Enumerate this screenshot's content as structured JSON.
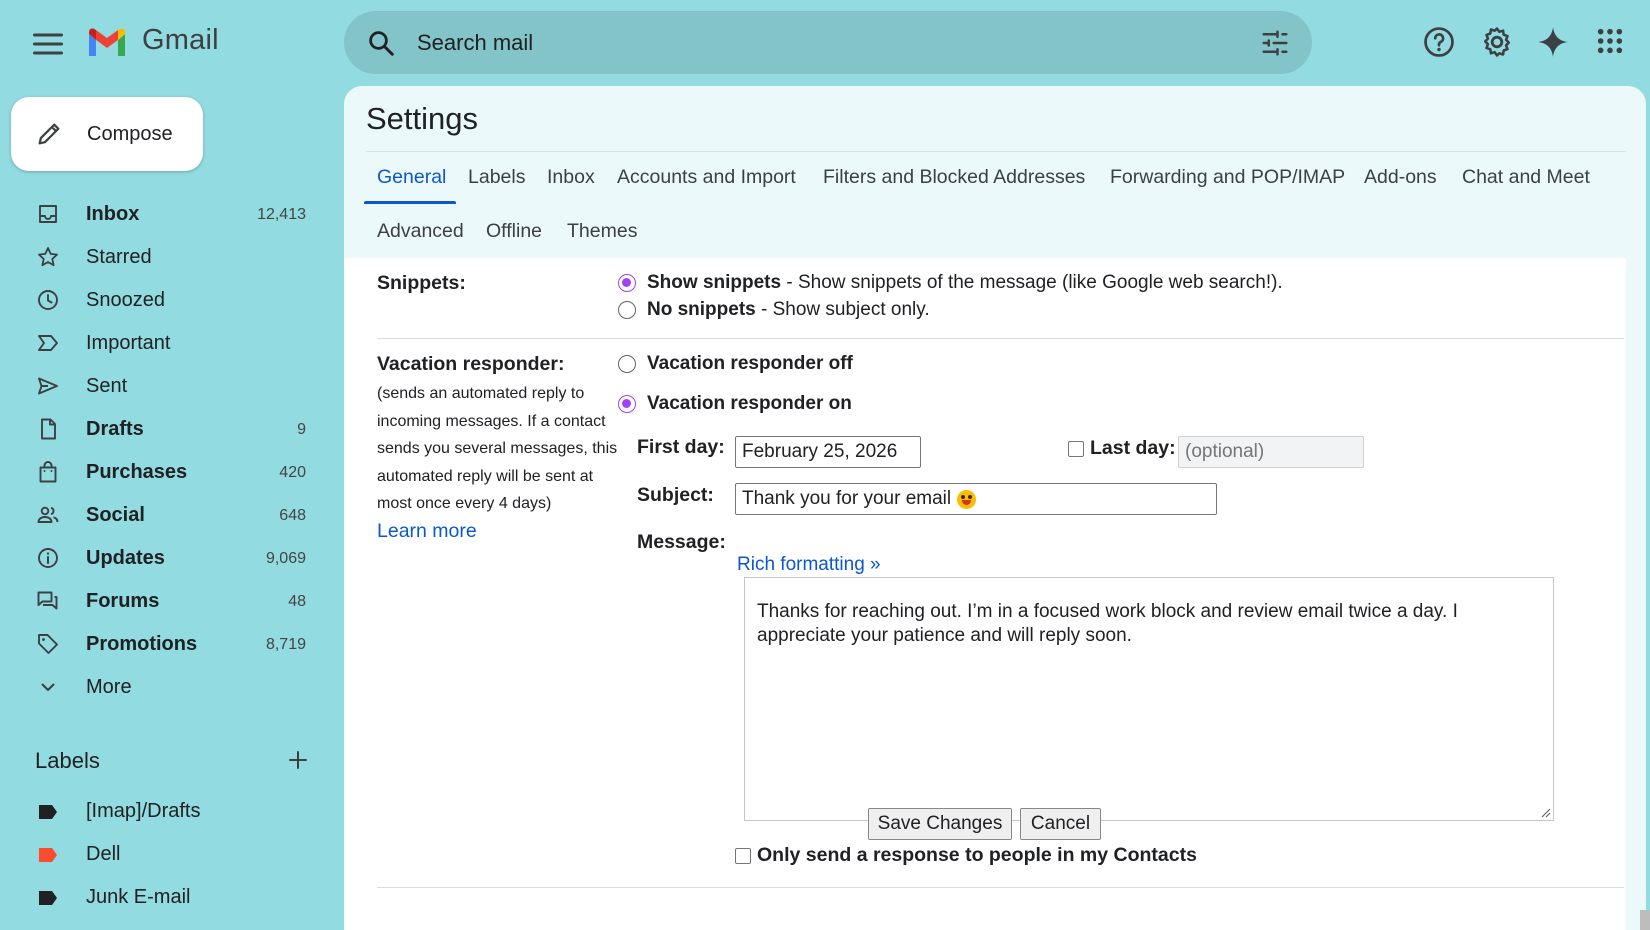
{
  "header": {
    "app_name": "Gmail",
    "search_placeholder": "Search mail"
  },
  "sidebar": {
    "compose_label": "Compose",
    "items": [
      {
        "label": "Inbox",
        "count": "12,413",
        "bold": true,
        "icon": "inbox-icon"
      },
      {
        "label": "Starred",
        "count": "",
        "bold": false,
        "icon": "star-icon"
      },
      {
        "label": "Snoozed",
        "count": "",
        "bold": false,
        "icon": "clock-icon"
      },
      {
        "label": "Important",
        "count": "",
        "bold": false,
        "icon": "important-icon"
      },
      {
        "label": "Sent",
        "count": "",
        "bold": false,
        "icon": "send-icon"
      },
      {
        "label": "Drafts",
        "count": "9",
        "bold": true,
        "icon": "draft-icon"
      },
      {
        "label": "Purchases",
        "count": "420",
        "bold": true,
        "icon": "shopping-bag-icon"
      },
      {
        "label": "Social",
        "count": "648",
        "bold": true,
        "icon": "people-icon"
      },
      {
        "label": "Updates",
        "count": "9,069",
        "bold": true,
        "icon": "info-icon"
      },
      {
        "label": "Forums",
        "count": "48",
        "bold": true,
        "icon": "forum-icon"
      },
      {
        "label": "Promotions",
        "count": "8,719",
        "bold": true,
        "icon": "tag-icon"
      },
      {
        "label": "More",
        "count": "",
        "bold": false,
        "icon": "chevron-down-icon"
      }
    ],
    "labels_heading": "Labels",
    "labels": [
      {
        "label": "[Imap]/Drafts",
        "color": "#202124"
      },
      {
        "label": "Dell",
        "color": "#fb4c2f"
      },
      {
        "label": "Junk E-mail",
        "color": "#202124"
      }
    ]
  },
  "settings": {
    "title": "Settings",
    "tabs": [
      "General",
      "Labels",
      "Inbox",
      "Accounts and Import",
      "Filters and Blocked Addresses",
      "Forwarding and POP/IMAP",
      "Add-ons",
      "Chat and Meet",
      "Advanced",
      "Offline",
      "Themes"
    ],
    "active_tab": "General",
    "snippets": {
      "label": "Snippets:",
      "show_title": "Show snippets",
      "show_desc": " - Show snippets of the message (like Google web search!).",
      "none_title": "No snippets",
      "none_desc": " - Show subject only.",
      "selected": "show"
    },
    "vacation": {
      "label": "Vacation responder:",
      "description": "(sends an automated reply to incoming messages. If a contact sends you several messages, this automated reply will be sent at most once every 4 days)",
      "learn_more": "Learn more",
      "off_label": "Vacation responder off",
      "on_label": "Vacation responder on",
      "selected": "on",
      "first_day_label": "First day:",
      "first_day_value": "February 25, 2026",
      "last_day_label": "Last day:",
      "last_day_placeholder": "(optional)",
      "subject_label": "Subject:",
      "subject_value": "Thank you for your email",
      "message_label": "Message:",
      "rich_formatting": "Rich formatting »",
      "message_body": "Thanks for reaching out. I’m in a focused work block and review email twice a day. I appreciate your patience and will reply soon.",
      "contacts_only_label": "Only send a response to people in my Contacts"
    },
    "save_label": "Save Changes",
    "cancel_label": "Cancel"
  },
  "colors": {
    "background": "#92dbe0",
    "accent": "#0b57d0",
    "radio_selected": "#a142f4"
  }
}
